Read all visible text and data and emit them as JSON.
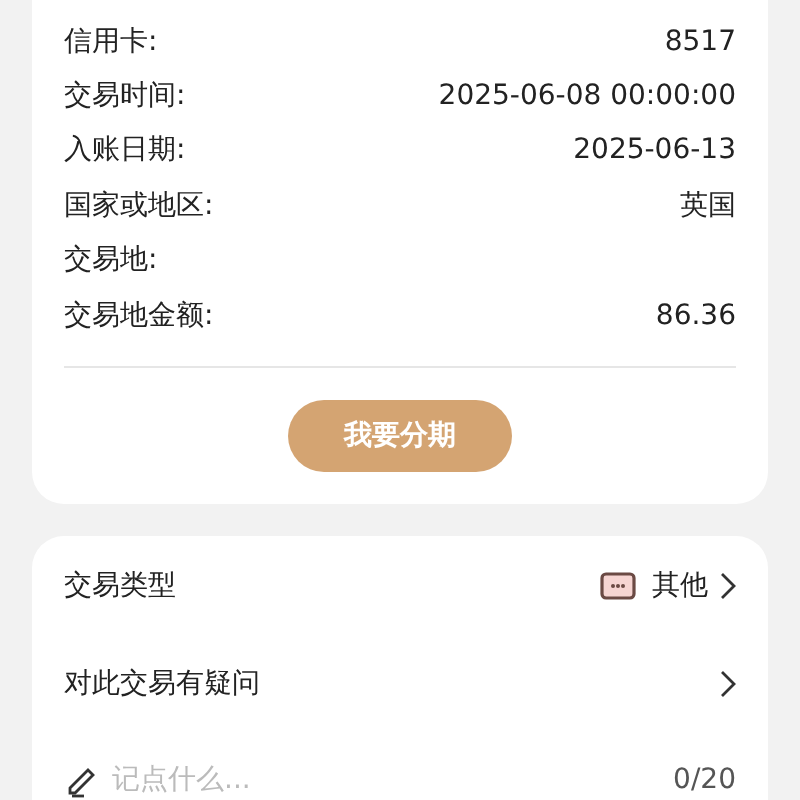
{
  "details": [
    {
      "label": "信用卡:",
      "value": "8517"
    },
    {
      "label": "交易时间:",
      "value": "2025-06-08 00:00:00"
    },
    {
      "label": "入账日期:",
      "value": "2025-06-13"
    },
    {
      "label": "国家或地区:",
      "value": "英国"
    },
    {
      "label": "交易地:"
    },
    {
      "label": "交易地金额:",
      "value": "86.36"
    }
  ],
  "installment_button": "我要分期",
  "options": [
    {
      "label": "交易类型",
      "value": "其他",
      "kind": "category"
    },
    {
      "label": "对此交易有疑问",
      "kind": "link"
    }
  ],
  "note": {
    "placeholder": "记点什么...",
    "counter": "0/20"
  }
}
